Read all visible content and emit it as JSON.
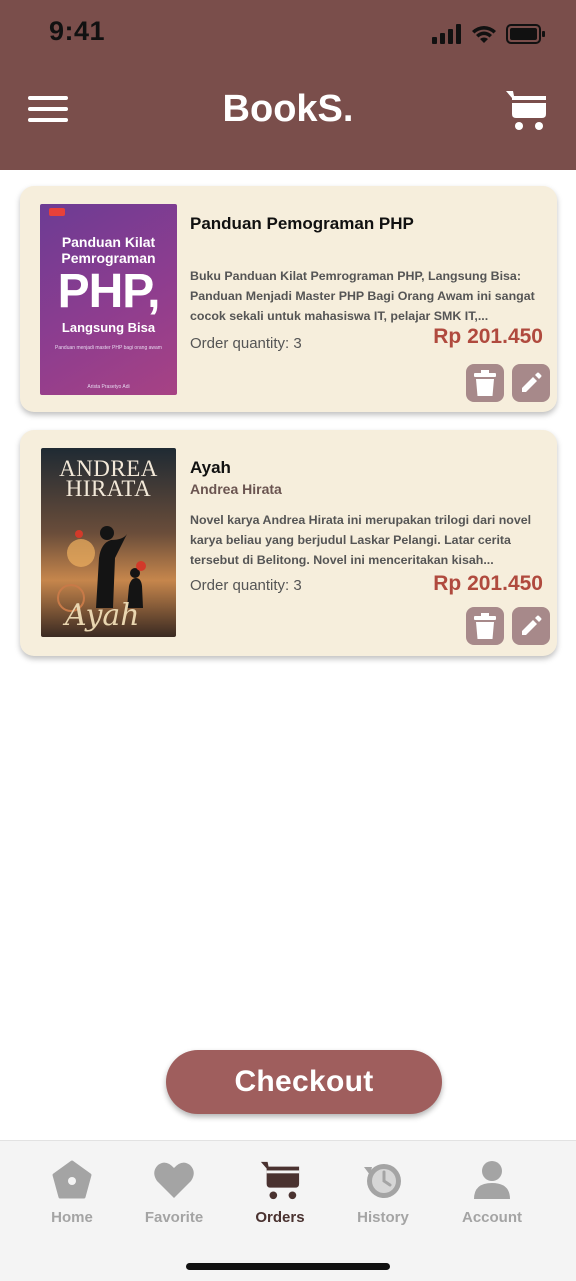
{
  "status_bar": {
    "time": "9:41"
  },
  "header": {
    "title": "BookS."
  },
  "books": [
    {
      "title": "Panduan Pemograman PHP",
      "author": "",
      "description": "Buku Panduan Kilat Pemrograman PHP, Langsung Bisa: Panduan Menjadi Master PHP Bagi Orang Awam ini sangat cocok sekali untuk mahasiswa IT, pelajar SMK IT,...",
      "quantity": "Order quantity: 3",
      "price": "Rp 201.450",
      "cover": {
        "line1": "Panduan Kilat",
        "line2": "Pemrograman",
        "big": "PHP,",
        "line3": "Langsung Bisa",
        "subtitle": "Panduan menjadi master PHP bagi orang awam",
        "author": "Arista Prasetyo Adi"
      }
    },
    {
      "title": "Ayah",
      "author": "Andrea Hirata",
      "description": "Novel karya Andrea Hirata ini merupakan trilogi dari novel karya beliau yang berjudul Laskar Pelangi. Latar cerita tersebut di Belitong. Novel ini menceritakan kisah...",
      "quantity": "Order quantity: 3",
      "price": "Rp 201.450",
      "cover": {
        "line1": "ANDREA",
        "line2": "HIRATA",
        "script": "Ayah"
      }
    }
  ],
  "checkout_label": "Checkout",
  "tabs": [
    {
      "label": "Home",
      "icon": "home-icon",
      "active": false
    },
    {
      "label": "Favorite",
      "icon": "heart-icon",
      "active": false
    },
    {
      "label": "Orders",
      "icon": "cart-icon",
      "active": true
    },
    {
      "label": "History",
      "icon": "history-icon",
      "active": false
    },
    {
      "label": "Account",
      "icon": "person-icon",
      "active": false
    }
  ],
  "colors": {
    "header": "#7a4e4b",
    "card": "#f6eedc",
    "price": "#b04a3e",
    "checkout": "#9f5e5d",
    "action_button": "#a7898a"
  }
}
